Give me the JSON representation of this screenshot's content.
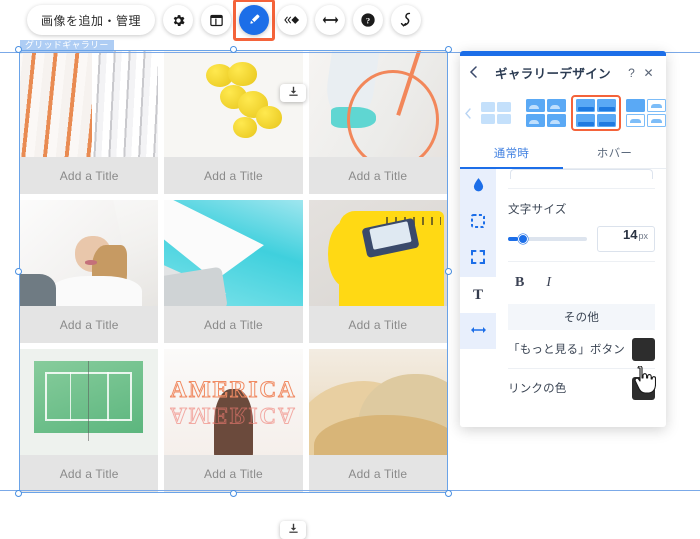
{
  "toolbar": {
    "add_manage_label": "画像を追加・管理",
    "buttons": [
      {
        "name": "settings-icon",
        "label": "設定"
      },
      {
        "name": "layout-icon",
        "label": "レイアウト"
      },
      {
        "name": "design-brush-icon",
        "label": "デザイン"
      },
      {
        "name": "animation-icon",
        "label": "アニメーション"
      },
      {
        "name": "stretch-icon",
        "label": "ストレッチ"
      },
      {
        "name": "help-icon",
        "label": "ヘルプ"
      },
      {
        "name": "link-icon",
        "label": "リンク"
      }
    ],
    "highlight_color": "#f4633a",
    "active_color": "#1c6ee8"
  },
  "canvas": {
    "gallery_label": "グリッドギャラリー",
    "stretch_handle_icon": "download-arrow-icon",
    "tiles": [
      {
        "caption": "Add a Title",
        "art": "building"
      },
      {
        "caption": "Add a Title",
        "art": "lemon"
      },
      {
        "caption": "Add a Title",
        "art": "bike"
      },
      {
        "caption": "Add a Title",
        "art": "woman"
      },
      {
        "caption": "Add a Title",
        "art": "wing"
      },
      {
        "caption": "Add a Title",
        "art": "chair"
      },
      {
        "caption": "Add a Title",
        "art": "court"
      },
      {
        "caption": "Add a Title",
        "art": "america"
      },
      {
        "caption": "Add a Title",
        "art": "dune"
      }
    ],
    "america_text": "AMERICA"
  },
  "panel": {
    "title": "ギャラリーデザイン",
    "back_icon": "chevron-left-icon",
    "help_icon": "question-mark-icon",
    "close_icon": "close-x-icon",
    "accent_color": "#1c6ee8",
    "layouts": {
      "prev_icon": "chevron-left-icon",
      "selected_index": 1,
      "options": [
        "layout-grid-plain",
        "layout-grid-caption",
        "layout-mixed"
      ]
    },
    "tabs": [
      {
        "label": "通常時",
        "active": true
      },
      {
        "label": "ホバー",
        "active": false
      }
    ],
    "rail": [
      {
        "name": "droplet-icon",
        "active": true
      },
      {
        "name": "dashed-square-icon",
        "active": true
      },
      {
        "name": "corners-icon",
        "active": true
      },
      {
        "name": "text-t-icon",
        "active": false
      },
      {
        "name": "horizontal-arrows-icon",
        "active": true
      }
    ],
    "font_size": {
      "label": "文字サイズ",
      "value": "14",
      "unit": "px",
      "percent": 13
    },
    "bold_label": "B",
    "italic_label": "I",
    "section_other": "その他",
    "options": [
      {
        "label": "「もっと見る」ボタン",
        "color": "#2d2d2d"
      },
      {
        "label": "リンクの色",
        "color": "#2d2d2d"
      }
    ]
  }
}
